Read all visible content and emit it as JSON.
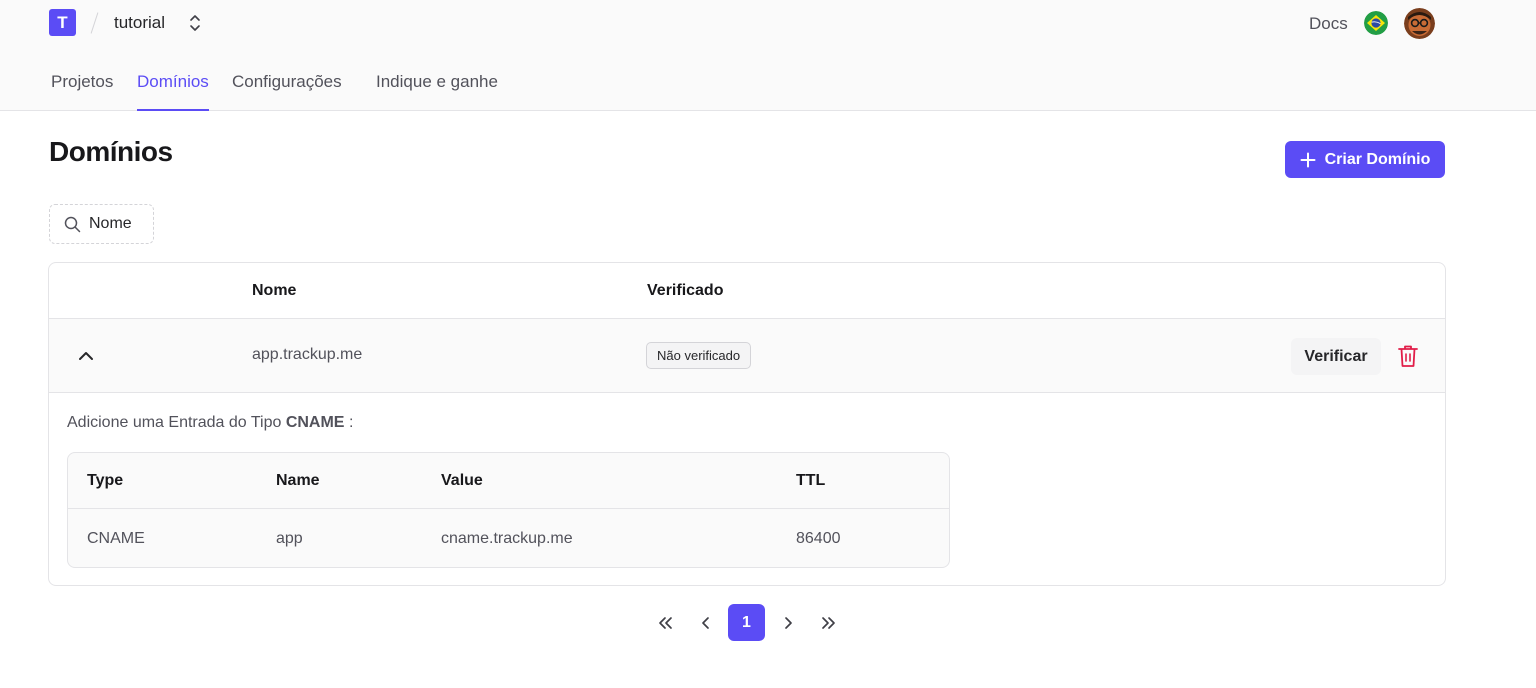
{
  "header": {
    "logo_letter": "T",
    "project_name": "tutorial",
    "docs_label": "Docs"
  },
  "tabs": [
    {
      "label": "Projetos",
      "active": false
    },
    {
      "label": "Domínios",
      "active": true
    },
    {
      "label": "Configurações",
      "active": false
    },
    {
      "label": "Indique e ganhe",
      "active": false
    }
  ],
  "page": {
    "title": "Domínios",
    "create_button_label": "Criar Domínio"
  },
  "search": {
    "placeholder": "Nome"
  },
  "table": {
    "headers": {
      "name": "Nome",
      "verified": "Verificado"
    },
    "rows": [
      {
        "domain": "app.trackup.me",
        "status": "Não verificado",
        "verify_label": "Verificar",
        "expanded": true
      }
    ]
  },
  "dns": {
    "instruction_prefix": "Adicione uma Entrada do Tipo",
    "record_type": "CNAME",
    "instruction_suffix": ":",
    "headers": {
      "type": "Type",
      "name": "Name",
      "value": "Value",
      "ttl": "TTL"
    },
    "record": {
      "type": "CNAME",
      "name": "app",
      "value": "cname.trackup.me",
      "ttl": "86400"
    }
  },
  "pagination": {
    "current_page": "1"
  },
  "colors": {
    "accent": "#5b4cf5",
    "danger": "#e11d48"
  }
}
